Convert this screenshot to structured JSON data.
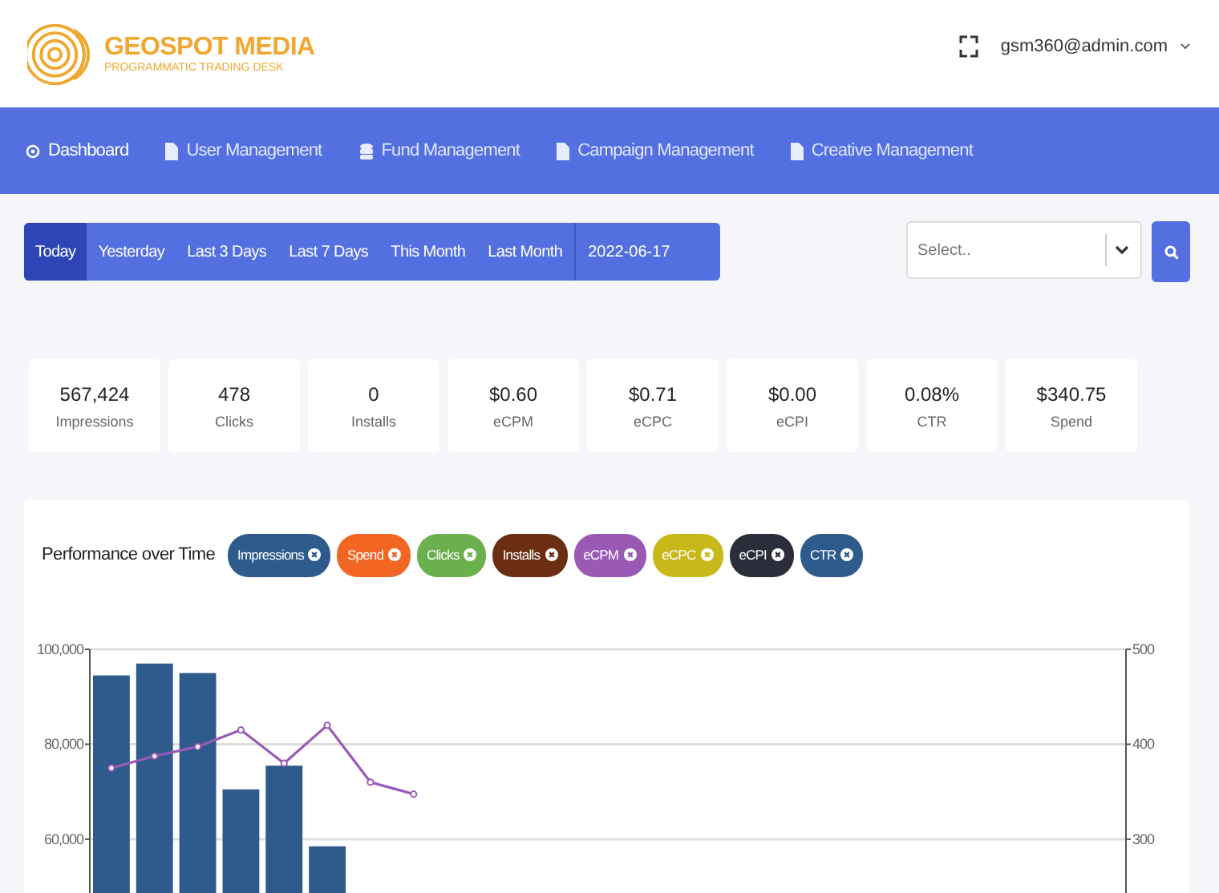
{
  "brand": {
    "name": "GEOSPOT MEDIA",
    "tagline": "PROGRAMMATIC TRADING DESK"
  },
  "user": {
    "email": "gsm360@admin.com"
  },
  "nav": [
    {
      "label": "Dashboard",
      "kind": "home",
      "selected": true
    },
    {
      "label": "User Management",
      "kind": "doc",
      "selected": false
    },
    {
      "label": "Fund Management",
      "kind": "coins",
      "selected": false
    },
    {
      "label": "Campaign Management",
      "kind": "doc",
      "selected": false
    },
    {
      "label": "Creative Management",
      "kind": "doc",
      "selected": false
    }
  ],
  "ranges": [
    {
      "label": "Today",
      "selected": true
    },
    {
      "label": "Yesterday",
      "selected": false
    },
    {
      "label": "Last 3 Days",
      "selected": false
    },
    {
      "label": "Last 7 Days",
      "selected": false
    },
    {
      "label": "This Month",
      "selected": false
    },
    {
      "label": "Last Month",
      "selected": false
    }
  ],
  "date": "2022-06-17",
  "select": {
    "placeholder": "Select.."
  },
  "stats": [
    {
      "value": "567,424",
      "label": "Impressions"
    },
    {
      "value": "478",
      "label": "Clicks"
    },
    {
      "value": "0",
      "label": "Installs"
    },
    {
      "value": "$0.60",
      "label": "eCPM"
    },
    {
      "value": "$0.71",
      "label": "eCPC"
    },
    {
      "value": "$0.00",
      "label": "eCPI"
    },
    {
      "value": "0.08%",
      "label": "CTR"
    },
    {
      "value": "$340.75",
      "label": "Spend"
    }
  ],
  "chart": {
    "title": "Performance over Time",
    "filters": [
      {
        "label": "Impressions",
        "color": "#2e5a8c"
      },
      {
        "label": "Spend",
        "color": "#f26522"
      },
      {
        "label": "Clicks",
        "color": "#6ab04c"
      },
      {
        "label": "Installs",
        "color": "#6b2e12"
      },
      {
        "label": "eCPM",
        "color": "#9b59b6"
      },
      {
        "label": "eCPC",
        "color": "#c9b81a"
      },
      {
        "label": "eCPI",
        "color": "#2b2d3a"
      },
      {
        "label": "CTR",
        "color": "#2e5a8c"
      }
    ],
    "chart_data": {
      "type": "bar",
      "ylim": [
        48000,
        100000
      ],
      "yticks": [
        {
          "value": 60000,
          "label": "60,000"
        },
        {
          "value": 80000,
          "label": "80,000"
        },
        {
          "value": 100000,
          "label": "100,000"
        }
      ],
      "series": [
        {
          "type": "bar",
          "color": "#2e5a8c",
          "values": [
            94500,
            97000,
            95000,
            70500,
            75500,
            58500,
            null,
            null,
            null,
            null,
            null,
            null,
            null,
            null,
            null,
            null,
            null,
            null,
            null,
            null,
            null,
            null,
            null,
            null
          ]
        },
        {
          "type": "line",
          "marker": "circle",
          "color": "#9b59b6",
          "values": [
            75000,
            77500,
            79500,
            83000,
            76000,
            84000,
            72000,
            69500,
            null,
            null,
            null,
            null,
            null,
            null,
            null,
            null,
            null,
            null,
            null,
            null,
            null,
            null,
            null,
            null
          ]
        }
      ]
    },
    "right_axis_ticks": [
      "500",
      "400",
      "300"
    ]
  }
}
